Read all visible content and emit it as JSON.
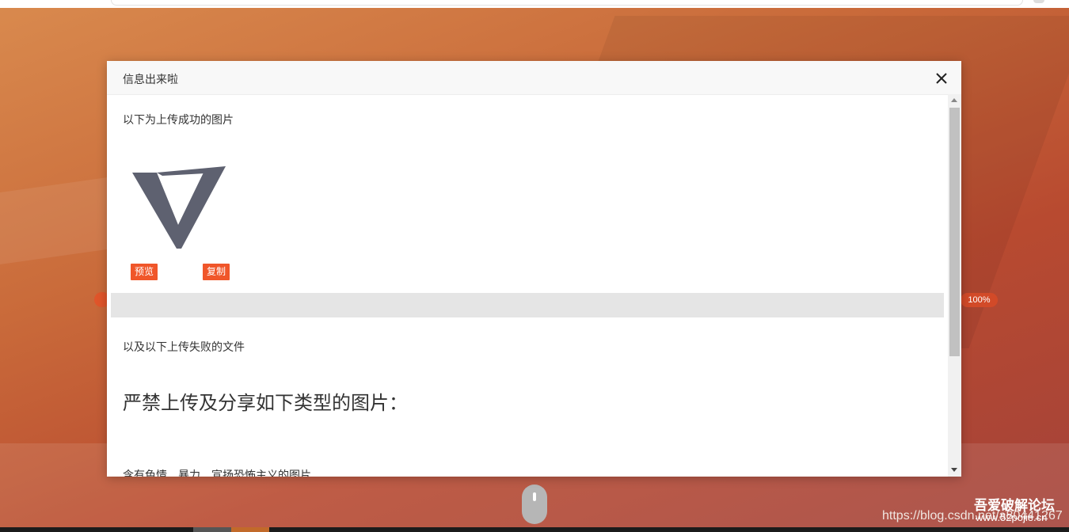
{
  "background": {
    "progress_badge": "100%"
  },
  "watermark": {
    "url": "https://blog.csdn.net/a80441267",
    "brand": "吾爱破解论坛",
    "site": "www.52pojie.cn"
  },
  "modal": {
    "title": "信息出来啦",
    "success_heading": "以下为上传成功的图片",
    "preview_label": "预览",
    "copy_label": "复制",
    "failed_heading": "以及以下上传失败的文件",
    "rules_heading": "严禁上传及分享如下类型的图片：",
    "rules_first_item": "含有色情、暴力、宣扬恐怖主义的图片"
  },
  "icons": {
    "close": "close-icon",
    "mouse": "mouse-scroll-icon"
  },
  "colors": {
    "accent": "#f0562a",
    "badge": "#d24a28"
  }
}
